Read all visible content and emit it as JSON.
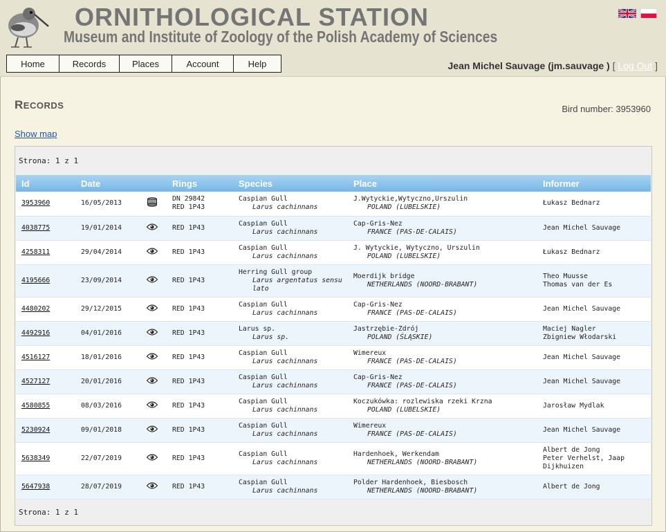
{
  "header": {
    "title": "ORNITHOLOGICAL STATION",
    "subtitle": "Museum and Institute of Zoology of the Polish Academy of Sciences",
    "logo_icon": "kiwi-bird-logo",
    "flags": [
      "uk-flag-icon",
      "pl-flag-icon"
    ]
  },
  "nav": {
    "items": [
      {
        "label": "Home"
      },
      {
        "label": "Records"
      },
      {
        "label": "Places"
      },
      {
        "label": "Account"
      },
      {
        "label": "Help"
      }
    ]
  },
  "user": {
    "name": "Jean Michel Sauvage (jm.sauvage )",
    "bracket_open": "[",
    "logout": "Log Out",
    "bracket_close": "]"
  },
  "page": {
    "title": "Records",
    "bird_number": "Bird number: 3953960",
    "show_map": "Show map"
  },
  "pager": {
    "top": "Strona: 1 z 1",
    "bottom": "Strona: 1 z 1"
  },
  "table": {
    "columns": [
      "Id",
      "Date",
      "",
      "Rings",
      "Species",
      "Place",
      "Informer"
    ],
    "rows": [
      {
        "id": "3953960",
        "date": "16/05/2013",
        "icon": "ring-icon",
        "rings": [
          "DN 29842",
          "RED 1P43"
        ],
        "species": "Caspian Gull",
        "latin": "Larus cachinnans",
        "place": "J.Wytyckie,Wytyczno,Urszulin",
        "country": "POLAND (LUBELSKIE)",
        "informer": [
          "Łukasz Bednarz"
        ]
      },
      {
        "id": "4038775",
        "date": "19/01/2014",
        "icon": "eye-icon",
        "rings": [
          "RED 1P43"
        ],
        "species": "Caspian Gull",
        "latin": "Larus cachinnans",
        "place": "Cap-Gris-Nez",
        "country": "FRANCE (PAS-DE-CALAIS)",
        "informer": [
          "Jean Michel Sauvage"
        ]
      },
      {
        "id": "4258311",
        "date": "29/04/2014",
        "icon": "eye-icon",
        "rings": [
          "RED 1P43"
        ],
        "species": "Caspian Gull",
        "latin": "Larus cachinnans",
        "place": "J. Wytyckie, Wytyczno, Urszulin",
        "country": "POLAND (LUBELSKIE)",
        "informer": [
          "Łukasz Bednarz"
        ]
      },
      {
        "id": "4195666",
        "date": "23/09/2014",
        "icon": "eye-icon",
        "rings": [
          "RED 1P43"
        ],
        "species": "Herring Gull group",
        "latin": "Larus argentatus sensu lato",
        "place": "Moerdijk bridge",
        "country": "NETHERLANDS (NOORD-BRABANT)",
        "informer": [
          "Theo Muusse",
          "Thomas van der Es"
        ]
      },
      {
        "id": "4480202",
        "date": "29/12/2015",
        "icon": "eye-icon",
        "rings": [
          "RED 1P43"
        ],
        "species": "Caspian Gull",
        "latin": "Larus cachinnans",
        "place": "Cap-Gris-Nez",
        "country": "FRANCE (PAS-DE-CALAIS)",
        "informer": [
          "Jean Michel Sauvage"
        ]
      },
      {
        "id": "4492916",
        "date": "04/01/2016",
        "icon": "eye-icon",
        "rings": [
          "RED 1P43"
        ],
        "species": "Larus sp.",
        "latin": "Larus sp.",
        "place": "Jastrzębie-Zdrój",
        "country": "POLAND (ŚLĄSKIE)",
        "informer": [
          "Maciej Nagler",
          "Zbigniew Włodarski"
        ]
      },
      {
        "id": "4516127",
        "date": "18/01/2016",
        "icon": "eye-icon",
        "rings": [
          "RED 1P43"
        ],
        "species": "Caspian Gull",
        "latin": "Larus cachinnans",
        "place": "Wimereux",
        "country": "FRANCE (PAS-DE-CALAIS)",
        "informer": [
          "Jean Michel Sauvage"
        ]
      },
      {
        "id": "4527127",
        "date": "20/01/2016",
        "icon": "eye-icon",
        "rings": [
          "RED 1P43"
        ],
        "species": "Caspian Gull",
        "latin": "Larus cachinnans",
        "place": "Cap-Gris-Nez",
        "country": "FRANCE (PAS-DE-CALAIS)",
        "informer": [
          "Jean Michel Sauvage"
        ]
      },
      {
        "id": "4580855",
        "date": "08/03/2016",
        "icon": "eye-icon",
        "rings": [
          "RED 1P43"
        ],
        "species": "Caspian Gull",
        "latin": "Larus cachinnans",
        "place": "Koczukówka: rozlewiska rzeki Krzna",
        "country": "POLAND (LUBELSKIE)",
        "informer": [
          "Jarosław Mydlak"
        ]
      },
      {
        "id": "5230924",
        "date": "09/01/2018",
        "icon": "eye-icon",
        "rings": [
          "RED 1P43"
        ],
        "species": "Caspian Gull",
        "latin": "Larus cachinnans",
        "place": "Wimereux",
        "country": "FRANCE (PAS-DE-CALAIS)",
        "informer": [
          "Jean Michel Sauvage"
        ]
      },
      {
        "id": "5638349",
        "date": "22/07/2019",
        "icon": "eye-icon",
        "rings": [
          "RED 1P43"
        ],
        "species": "Caspian Gull",
        "latin": "Larus cachinnans",
        "place": "Hardenhoek, Werkendam",
        "country": "NETHERLANDS (NOORD-BRABANT)",
        "informer": [
          "Albert de Jong",
          "Peter Verhelst, Jaap",
          "Dijkhuizen"
        ]
      },
      {
        "id": "5647938",
        "date": "28/07/2019",
        "icon": "eye-icon",
        "rings": [
          "RED 1P43"
        ],
        "species": "Caspian Gull",
        "latin": "Larus cachinnans",
        "place": "Polder Hardenhoek, Biesbosch",
        "country": "NETHERLANDS (NOORD-BRABANT)",
        "informer": [
          "Albert de Jong"
        ]
      }
    ]
  },
  "colors": {
    "header_bg": "#e6e3d1",
    "page_bg": "#f6f3e3",
    "table_header": "#8ec5ee",
    "row_alt": "#edf5fc",
    "title_gray": "#757575"
  }
}
